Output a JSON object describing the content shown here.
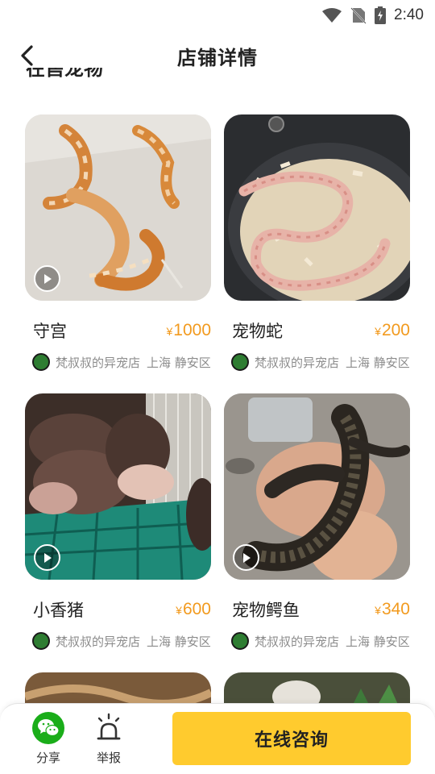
{
  "status_bar": {
    "time": "2:40"
  },
  "header": {
    "title": "店铺详情"
  },
  "section": {
    "title_partial": "在售宠物"
  },
  "products": [
    {
      "name": "守宫",
      "currency": "¥",
      "price": "1000",
      "shop": "梵叔叔的异宠店",
      "location": "上海 静安区",
      "video": true,
      "photo": "gecko"
    },
    {
      "name": "宠物蛇",
      "currency": "¥",
      "price": "200",
      "shop": "梵叔叔的异宠店",
      "location": "上海 静安区",
      "video": false,
      "photo": "snake"
    },
    {
      "name": "小香猪",
      "currency": "¥",
      "price": "600",
      "shop": "梵叔叔的异宠店",
      "location": "上海 静安区",
      "video": true,
      "photo": "piglets"
    },
    {
      "name": "宠物鳄鱼",
      "currency": "¥",
      "price": "340",
      "shop": "梵叔叔的异宠店",
      "location": "上海 静安区",
      "video": true,
      "photo": "crocodile"
    }
  ],
  "bottom_bar": {
    "share_label": "分享",
    "report_label": "举报",
    "consult_label": "在线咨询"
  },
  "colors": {
    "accent": "#ffcb2e",
    "price": "#f29a1e",
    "wechat": "#1aad19"
  }
}
